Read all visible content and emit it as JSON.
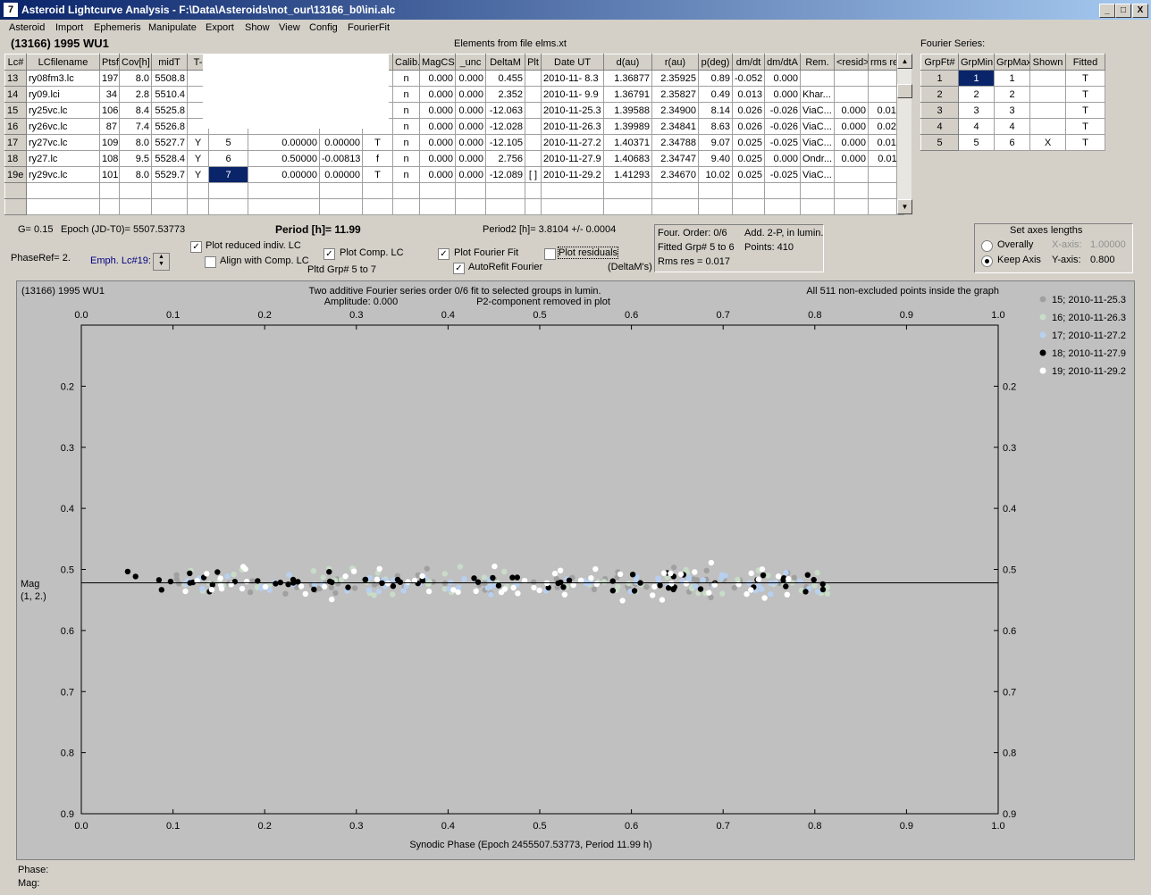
{
  "window": {
    "app_icon": "7",
    "title": "Asteroid Lightcurve Analysis - F:\\Data\\Asteroids\\not_our\\13166_b0\\ini.alc",
    "min": "_",
    "max": "□",
    "close": "X"
  },
  "menu": [
    "Asteroid",
    "Import",
    "Ephemeris",
    "Manipulate",
    "Export",
    "Show",
    "View",
    "Config",
    "FourierFit"
  ],
  "object_title": "(13166) 1995 WU1",
  "elements_label": "Elements from file elms.xt",
  "lc_table": {
    "headers": [
      "Lc#",
      "LCfilename",
      "Ptsf",
      "Cov[h]",
      "midT",
      "T-",
      "",
      "",
      "",
      "",
      "Calib.",
      "MagCS",
      "_unc",
      "DeltaM",
      "Plt",
      "Date UT",
      "d(au)",
      "r(au)",
      "p(deg)",
      "dm/dt",
      "dm/dtA",
      "Rem.",
      "<resid>",
      "rms res"
    ],
    "rows": [
      [
        "13",
        "ry08fm3.lc",
        "197",
        "8.0",
        "5508.8",
        "",
        "",
        "",
        "",
        "",
        "n",
        "0.000",
        "0.000",
        "0.455",
        "",
        "2010-11- 8.3",
        "1.36877",
        "2.35925",
        "0.89",
        "-0.052",
        "0.000",
        "",
        "",
        ""
      ],
      [
        "14",
        "ry09.lci",
        "34",
        "2.8",
        "5510.4",
        "",
        "",
        "",
        "",
        "",
        "n",
        "0.000",
        "0.000",
        "2.352",
        "",
        "2010-11- 9.9",
        "1.36791",
        "2.35827",
        "0.49",
        "0.013",
        "0.000",
        "Khar...",
        "",
        ""
      ],
      [
        "15",
        "ry25vc.lc",
        "106",
        "8.4",
        "5525.8",
        "",
        "",
        "",
        "",
        "",
        "n",
        "0.000",
        "0.000",
        "-12.063",
        "",
        "2010-11-25.3",
        "1.39588",
        "2.34900",
        "8.14",
        "0.026",
        "-0.026",
        "ViaC...",
        "0.000",
        "0.016"
      ],
      [
        "16",
        "ry26vc.lc",
        "87",
        "7.4",
        "5526.8",
        "",
        "",
        "",
        "",
        "",
        "n",
        "0.000",
        "0.000",
        "-12.028",
        "",
        "2010-11-26.3",
        "1.39989",
        "2.34841",
        "8.63",
        "0.026",
        "-0.026",
        "ViaC...",
        "0.000",
        "0.025"
      ],
      [
        "17",
        "ry27vc.lc",
        "109",
        "8.0",
        "5527.7",
        "Y",
        "5",
        "0.00000",
        "0.00000",
        "T",
        "n",
        "0.000",
        "0.000",
        "-12.105",
        "",
        "2010-11-27.2",
        "1.40371",
        "2.34788",
        "9.07",
        "0.025",
        "-0.025",
        "ViaC...",
        "0.000",
        "0.015"
      ],
      [
        "18",
        "ry27.lc",
        "108",
        "9.5",
        "5528.4",
        "Y",
        "6",
        "0.50000",
        "-0.00813",
        "f",
        "n",
        "0.000",
        "0.000",
        "2.756",
        "",
        "2010-11-27.9",
        "1.40683",
        "2.34747",
        "9.40",
        "0.025",
        "0.000",
        "Ondr...",
        "0.000",
        "0.011"
      ],
      [
        "19e",
        "ry29vc.lc",
        "101",
        "8.0",
        "5529.7",
        "Y",
        "7",
        "0.00000",
        "0.00000",
        "T",
        "n",
        "0.000",
        "0.000",
        "-12.089",
        "[ ]",
        "2010-11-29.2",
        "1.41293",
        "2.34670",
        "10.02",
        "0.025",
        "-0.025",
        "ViaC...",
        "",
        ""
      ]
    ]
  },
  "fourier_series": {
    "label": "Fourier Series:",
    "headers": [
      "GrpFt#",
      "GrpMin",
      "GrpMax",
      "Shown",
      "Fitted"
    ],
    "rows": [
      [
        "1",
        "1",
        "1",
        "",
        "T"
      ],
      [
        "2",
        "2",
        "2",
        "",
        "T"
      ],
      [
        "3",
        "3",
        "3",
        "",
        "T"
      ],
      [
        "4",
        "4",
        "4",
        "",
        "T"
      ],
      [
        "5",
        "5",
        "6",
        "X",
        "T"
      ]
    ]
  },
  "info": {
    "g": "G= 0.15",
    "epoch": "Epoch (JD-T0)= 5507.53773",
    "period": "Period [h]= 11.99",
    "period2": "Period2 [h]= 3.8104 +/- 0.0004",
    "phaseref": "PhaseRef= 2.",
    "emph": "Emph. Lc#19:",
    "pltd_grp": "Pltd Grp#  5  to  7",
    "deltams": "(DeltaM's)"
  },
  "checkboxes": {
    "plot_reduced": {
      "label": "Plot reduced indiv. LC",
      "checked": true
    },
    "align_comp": {
      "label": "Align with Comp. LC",
      "checked": false
    },
    "plot_comp": {
      "label": "Plot Comp. LC",
      "checked": true
    },
    "plot_fourier": {
      "label": "Plot Fourier Fit",
      "checked": true
    },
    "autorefit": {
      "label": "AutoRefit Fourier",
      "checked": true
    },
    "plot_residuals": {
      "label": "Plot residuals",
      "checked": false
    }
  },
  "fit_box": {
    "order": "Four. Order:  0/6",
    "add": "Add. 2-P, in lumin.",
    "fitted": "Fitted Grp# 5 to 6",
    "points": "Points: 410",
    "rms": "Rms res     = 0.017"
  },
  "axes_box": {
    "title": "Set axes lengths",
    "overally": "Overally",
    "keep": "Keep Axis",
    "xaxis_label": "X-axis:",
    "xaxis_value": "1.00000",
    "yaxis_label": "Y-axis:",
    "yaxis_value": "0.800"
  },
  "chart_data": {
    "type": "scatter",
    "title_left": "(13166) 1995 WU1",
    "title_center_1": "Two additive Fourier series order 0/6 fit to selected groups in lumin.",
    "title_center_2": "Amplitude: 0.000",
    "title_center_3": "P2-component removed in plot",
    "title_right": "All 511 non-excluded points inside the graph",
    "xlabel": "Synodic Phase (Epoch 2455507.53773, Period 11.99 h)",
    "ylabel_1": "Mag",
    "ylabel_2": "(1, 2.)",
    "xlim": [
      0.0,
      1.0
    ],
    "ylim": [
      0.9,
      0.1
    ],
    "xticks": [
      "0.0",
      "0.1",
      "0.2",
      "0.3",
      "0.4",
      "0.5",
      "0.6",
      "0.7",
      "0.8",
      "0.9",
      "1.0"
    ],
    "yticks": [
      "0.2",
      "0.3",
      "0.4",
      "0.5",
      "0.6",
      "0.7",
      "0.8",
      "0.9"
    ],
    "fit_line_mag": 0.522,
    "series": [
      {
        "name": "15; 2010-11-25.3",
        "color": "#a0a0a0",
        "x_range": [
          0.1,
          0.81
        ],
        "mag_center": 0.522,
        "mag_spread": 0.03
      },
      {
        "name": "16; 2010-11-26.3",
        "color": "#c8dcc8",
        "x_range": [
          0.11,
          0.82
        ],
        "mag_center": 0.522,
        "mag_spread": 0.03
      },
      {
        "name": "17; 2010-11-27.2",
        "color": "#b8d0f0",
        "x_range": [
          0.11,
          0.81
        ],
        "mag_center": 0.522,
        "mag_spread": 0.02
      },
      {
        "name": "18; 2010-11-27.9",
        "color": "#000000",
        "x_range": [
          0.05,
          0.86
        ],
        "mag_center": 0.522,
        "mag_spread": 0.02
      },
      {
        "name": "19; 2010-11-29.2",
        "color": "#ffffff",
        "x_range": [
          0.1,
          0.79
        ],
        "mag_center": 0.522,
        "mag_spread": 0.035
      }
    ]
  },
  "status": {
    "phase": "Phase:",
    "mag": "Mag:"
  }
}
